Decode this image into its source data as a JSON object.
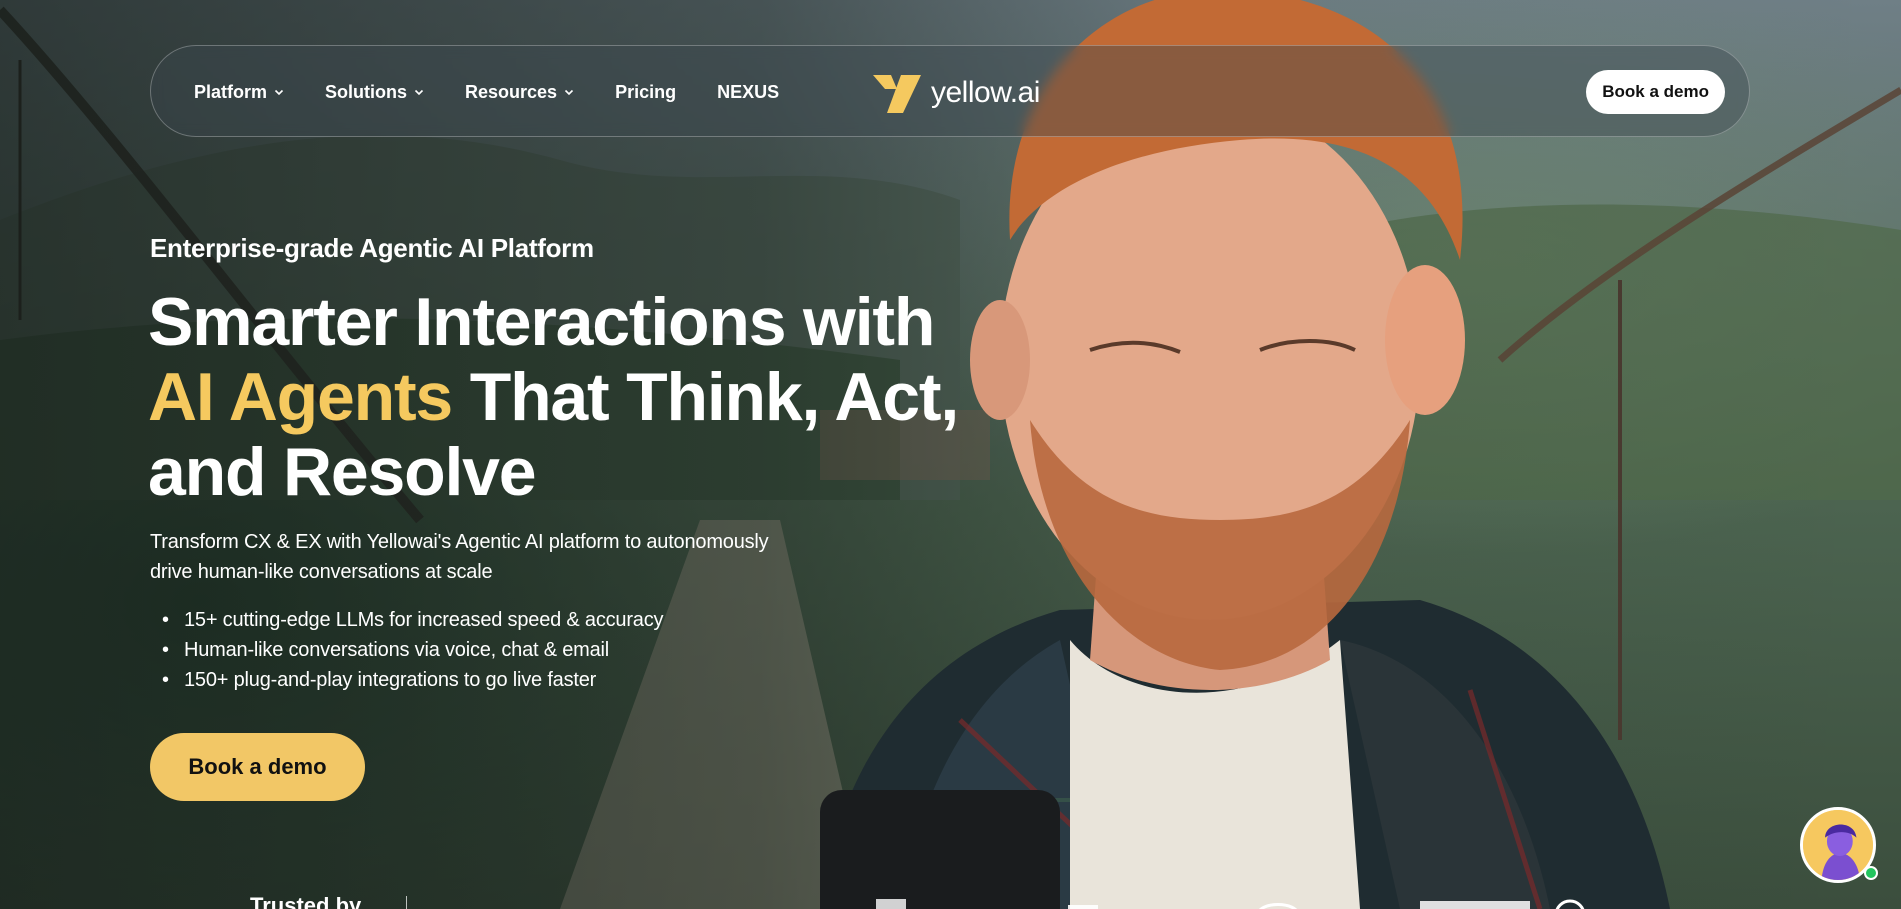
{
  "nav": {
    "items": [
      {
        "label": "Platform",
        "has_dropdown": true
      },
      {
        "label": "Solutions",
        "has_dropdown": true
      },
      {
        "label": "Resources",
        "has_dropdown": true
      },
      {
        "label": "Pricing",
        "has_dropdown": false
      },
      {
        "label": "NEXUS",
        "has_dropdown": false
      }
    ],
    "brand": "yellow.ai",
    "cta": "Book a demo"
  },
  "hero": {
    "eyebrow": "Enterprise-grade Agentic AI Platform",
    "headline_line1": "Smarter Interactions with",
    "headline_accent": "AI Agents",
    "headline_rest": " That Think, Act,",
    "headline_line3": "and Resolve",
    "subtitle": "Transform CX & EX with Yellowai's Agentic AI platform to autonomously drive human-like conversations at scale",
    "bullets": [
      "15+ cutting-edge LLMs for increased speed & accuracy",
      "Human-like conversations via voice, chat & email",
      "150+ plug-and-play integrations to go live faster"
    ],
    "cta": "Book a demo"
  },
  "trusted": {
    "label": "Trusted by"
  },
  "colors": {
    "accent": "#f5c95f",
    "cta_bg": "#f2c766",
    "online": "#22c55e"
  },
  "icons": {
    "brand": "yellow-ai-logo-icon",
    "dropdown": "chevron-down-icon",
    "chat": "chat-assistant-avatar-icon"
  }
}
